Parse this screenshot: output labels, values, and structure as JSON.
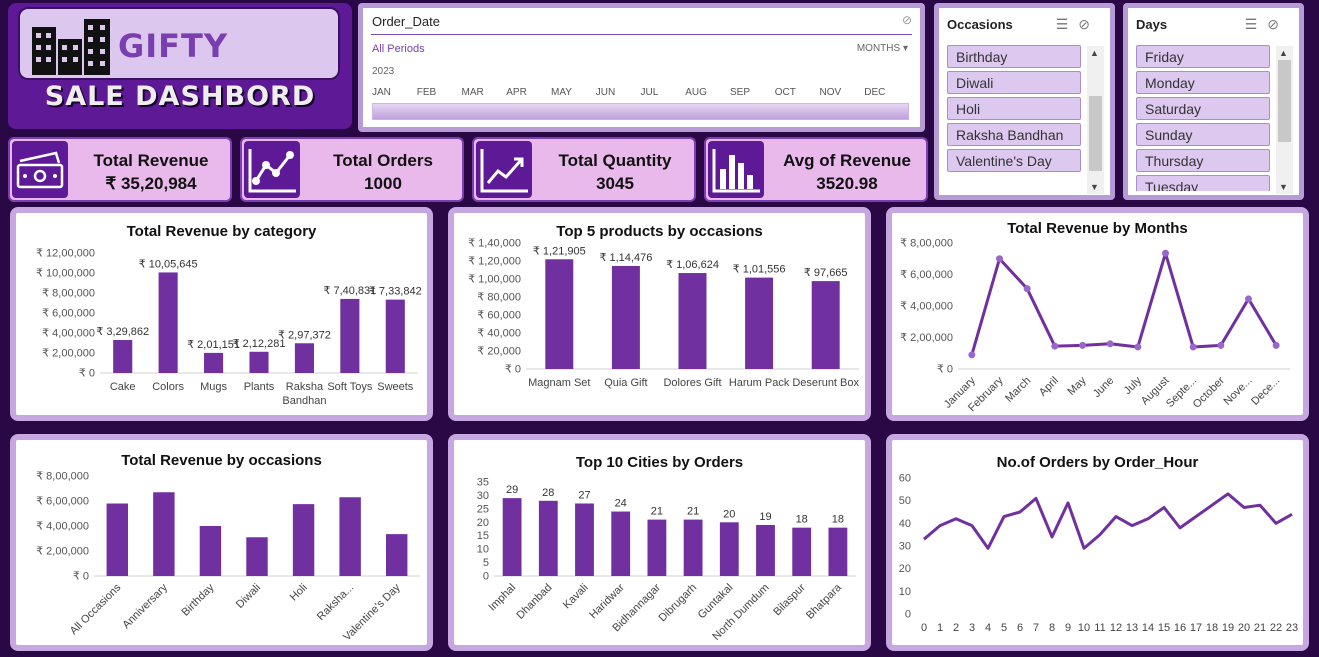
{
  "logo": {
    "title": "GIFTY",
    "subtitle": "SALE DASHBORD"
  },
  "timeline": {
    "title": "Order_Date",
    "period": "All Periods",
    "unit": "MONTHS",
    "year": "2023",
    "months": [
      "JAN",
      "FEB",
      "MAR",
      "APR",
      "MAY",
      "JUN",
      "JUL",
      "AUG",
      "SEP",
      "OCT",
      "NOV",
      "DEC"
    ]
  },
  "occasions_slicer": {
    "title": "Occasions",
    "items": [
      "Birthday",
      "Diwali",
      "Holi",
      "Raksha Bandhan",
      "Valentine's Day"
    ]
  },
  "days_slicer": {
    "title": "Days",
    "items": [
      "Friday",
      "Monday",
      "Saturday",
      "Sunday",
      "Thursday",
      "Tuesday"
    ]
  },
  "kpis": [
    {
      "label": "Total Revenue",
      "value": "₹ 35,20,984",
      "icon": "money-icon"
    },
    {
      "label": "Total Orders",
      "value": "1000",
      "icon": "line-chart-icon"
    },
    {
      "label": "Total Quantity",
      "value": "3045",
      "icon": "trend-up-icon"
    },
    {
      "label": "Avg of Revenue",
      "value": "3520.98",
      "icon": "bar-chart-icon"
    }
  ],
  "colors": {
    "accent": "#7030a0",
    "panel_border": "#c7a7e0",
    "background": "#2a0845"
  },
  "chart_data": [
    {
      "id": "rev_category",
      "type": "bar",
      "title": "Total Revenue by category",
      "categories": [
        "Cake",
        "Colors",
        "Mugs",
        "Plants",
        "Raksha Bandhan",
        "Soft Toys",
        "Sweets"
      ],
      "values": [
        329862,
        1005645,
        201151,
        212281,
        297372,
        740831,
        733842
      ],
      "value_labels": [
        "₹ 3,29,862",
        "₹ 10,05,645",
        "₹ 2,01,151",
        "₹ 2,12,281",
        "₹ 2,97,372",
        "₹ 7,40,831",
        "₹ 7,33,842"
      ],
      "ylim": [
        0,
        1200000
      ],
      "yticks": [
        "₹ 0",
        "₹ 2,00,000",
        "₹ 4,00,000",
        "₹ 6,00,000",
        "₹ 8,00,000",
        "₹ 10,00,000",
        "₹ 12,00,000"
      ]
    },
    {
      "id": "top_products",
      "type": "bar",
      "title": "Top 5 products by occasions",
      "categories": [
        "Magnam Set",
        "Quia Gift",
        "Dolores Gift",
        "Harum Pack",
        "Deserunt Box"
      ],
      "values": [
        121905,
        114476,
        106624,
        101556,
        97665
      ],
      "value_labels": [
        "₹ 1,21,905",
        "₹ 1,14,476",
        "₹ 1,06,624",
        "₹ 1,01,556",
        "₹ 97,665"
      ],
      "ylim": [
        0,
        140000
      ],
      "yticks": [
        "₹ 0",
        "₹ 20,000",
        "₹ 40,000",
        "₹ 60,000",
        "₹ 80,000",
        "₹ 1,00,000",
        "₹ 1,20,000",
        "₹ 1,40,000"
      ]
    },
    {
      "id": "rev_months",
      "type": "line",
      "title": "Total Revenue by Months",
      "categories": [
        "January",
        "February",
        "March",
        "April",
        "May",
        "June",
        "July",
        "August",
        "Septe...",
        "October",
        "Nove...",
        "Dece..."
      ],
      "values": [
        90000,
        700000,
        510000,
        145000,
        150000,
        160000,
        140000,
        735000,
        140000,
        150000,
        445000,
        150000
      ],
      "ylim": [
        0,
        800000
      ],
      "yticks": [
        "₹ 0",
        "₹ 2,00,000",
        "₹ 4,00,000",
        "₹ 6,00,000",
        "₹ 8,00,000"
      ]
    },
    {
      "id": "rev_occasions",
      "type": "bar",
      "title": "Total Revenue by occasions",
      "categories": [
        "All Occasions",
        "Anniversary",
        "Birthday",
        "Diwali",
        "Holi",
        "Raksha...",
        "Valentine's Day"
      ],
      "values": [
        580000,
        670000,
        400000,
        310000,
        575000,
        630000,
        335000
      ],
      "ylim": [
        0,
        800000
      ],
      "yticks": [
        "₹ 0",
        "₹ 2,00,000",
        "₹ 4,00,000",
        "₹ 6,00,000",
        "₹ 8,00,000"
      ]
    },
    {
      "id": "top_cities",
      "type": "bar",
      "title": "Top 10 Cities by Orders",
      "categories": [
        "Imphal",
        "Dhanbad",
        "Kavali",
        "Haridwar",
        "Bidhannagar",
        "Dibrugarh",
        "Guntakal",
        "North Dumdum",
        "Bilaspur",
        "Bhatpara"
      ],
      "values": [
        29,
        28,
        27,
        24,
        21,
        21,
        20,
        19,
        18,
        18
      ],
      "value_labels": [
        "29",
        "28",
        "27",
        "24",
        "21",
        "21",
        "20",
        "19",
        "18",
        "18"
      ],
      "ylim": [
        0,
        35
      ],
      "yticks": [
        "0",
        "5",
        "10",
        "15",
        "20",
        "25",
        "30",
        "35"
      ]
    },
    {
      "id": "orders_hour",
      "type": "line",
      "title": "No.of Orders by Order_Hour",
      "categories": [
        "0",
        "1",
        "2",
        "3",
        "4",
        "5",
        "6",
        "7",
        "8",
        "9",
        "10",
        "11",
        "12",
        "13",
        "14",
        "15",
        "16",
        "17",
        "18",
        "19",
        "20",
        "21",
        "22",
        "23"
      ],
      "values": [
        33,
        39,
        42,
        39,
        29,
        43,
        45,
        51,
        34,
        49,
        29,
        35,
        43,
        39,
        42,
        47,
        38,
        43,
        48,
        53,
        47,
        48,
        40,
        44
      ],
      "ylim": [
        0,
        60
      ],
      "yticks": [
        "0",
        "10",
        "20",
        "30",
        "40",
        "50",
        "60"
      ]
    }
  ]
}
